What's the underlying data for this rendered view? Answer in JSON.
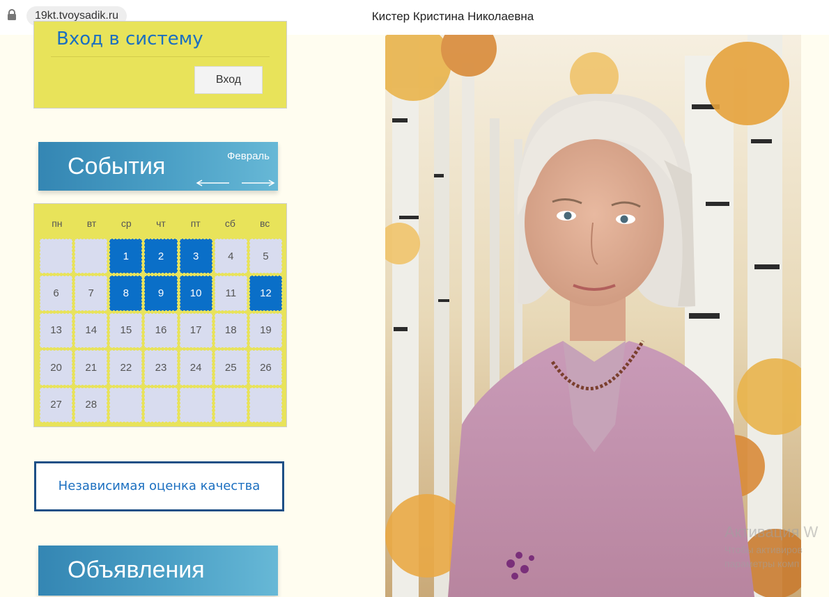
{
  "topbar": {
    "url": "19kt.tvoysadik.ru",
    "title": "Кистер Кристина Николаевна"
  },
  "login": {
    "title": "Вход в систему",
    "button": "Вход"
  },
  "events": {
    "title": "События",
    "month": "Февраль"
  },
  "calendar": {
    "weekdays": [
      "пн",
      "вт",
      "ср",
      "чт",
      "пт",
      "сб",
      "вс"
    ],
    "rows": [
      [
        "",
        "",
        "1",
        "2",
        "3",
        "4",
        "5"
      ],
      [
        "6",
        "7",
        "8",
        "9",
        "10",
        "11",
        "12"
      ],
      [
        "13",
        "14",
        "15",
        "16",
        "17",
        "18",
        "19"
      ],
      [
        "20",
        "21",
        "22",
        "23",
        "24",
        "25",
        "26"
      ],
      [
        "27",
        "28",
        "",
        "",
        "",
        "",
        ""
      ]
    ],
    "event_days": [
      "1",
      "2",
      "3",
      "8",
      "9",
      "10",
      "12"
    ]
  },
  "quality": {
    "label": "Независимая оценка качества"
  },
  "announcements": {
    "title": "Объявления"
  },
  "watermark": {
    "line1": "Активация W",
    "line2": "Чтобы активиров",
    "line3": "параметры комп"
  },
  "colors": {
    "accent": "#0a6fc8",
    "widget_bg": "#e8e35a",
    "banner": "#4ba0c6"
  }
}
